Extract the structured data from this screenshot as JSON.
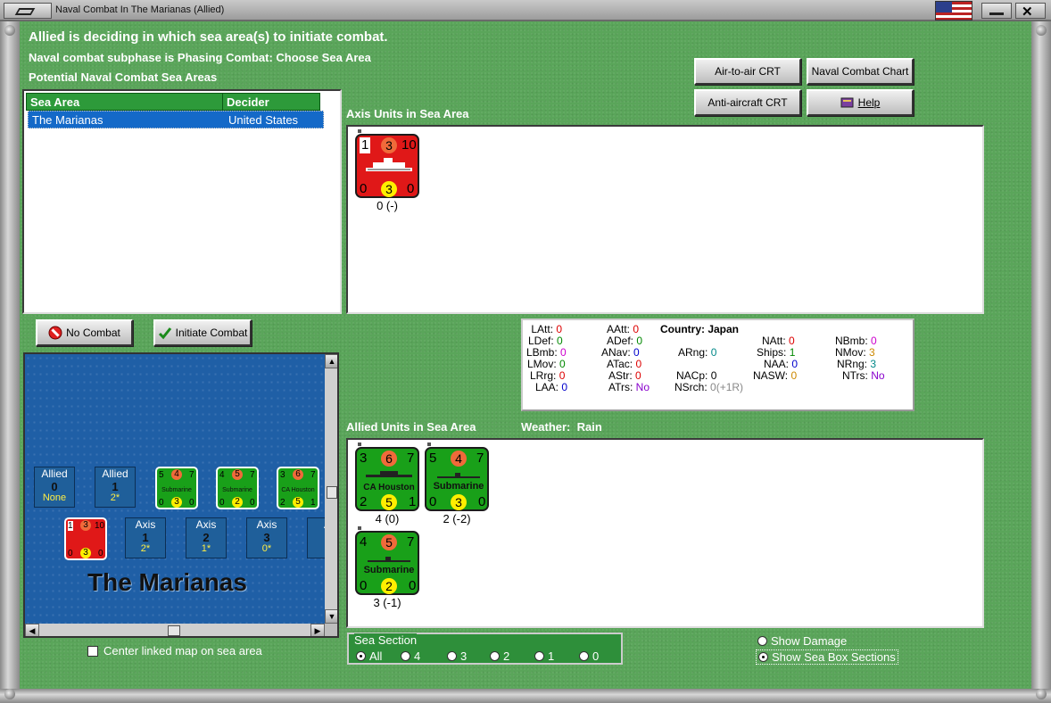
{
  "window": {
    "title": "Naval Combat In The Marianas (Allied)"
  },
  "header": {
    "line1": "Allied is deciding in which sea area(s) to initiate combat.",
    "line2": "Naval combat subphase is Phasing Combat: Choose Sea Area",
    "line3": "Potential Naval Combat Sea Areas"
  },
  "sea_table": {
    "columns": [
      "Sea Area",
      "Decider"
    ],
    "rows": [
      {
        "sea_area": "The Marianas",
        "decider": "United States"
      }
    ]
  },
  "buttons": {
    "air_to_air": "Air-to-air CRT",
    "naval_chart": "Naval Combat Chart",
    "anti_aircraft": "Anti-aircraft CRT",
    "help": "Help",
    "no_combat": "No Combat",
    "initiate": "Initiate Combat"
  },
  "axis": {
    "label": "Axis Units in Sea Area",
    "units": [
      {
        "top": [
          "1",
          "3",
          "10"
        ],
        "bottom": [
          "0",
          "3",
          "0"
        ],
        "name": "",
        "caption": "0 (-)"
      }
    ]
  },
  "stats": {
    "country_label": "Country: Japan",
    "col1": [
      {
        "k": "LAtt:",
        "v": "0"
      },
      {
        "k": "LDef:",
        "v": "0"
      },
      {
        "k": "LBmb:",
        "v": "0"
      },
      {
        "k": "LMov:",
        "v": "0"
      },
      {
        "k": "LRrg:",
        "v": "0"
      },
      {
        "k": "LAA:",
        "v": "0"
      }
    ],
    "col2": [
      {
        "k": "AAtt:",
        "v": "0"
      },
      {
        "k": "ADef:",
        "v": "0"
      },
      {
        "k": "ANav:",
        "v": "0"
      },
      {
        "k": "ATac:",
        "v": "0"
      },
      {
        "k": "AStr:",
        "v": "0"
      },
      {
        "k": "ATrs:",
        "v": "No"
      }
    ],
    "col3": [
      {
        "k": "ARng:",
        "v": "0"
      },
      {
        "k": "NACp:",
        "v": "0"
      },
      {
        "k": "NSrch:",
        "v": "0(+1R)"
      }
    ],
    "col4": [
      {
        "k": "NAtt:",
        "v": "0"
      },
      {
        "k": "Ships:",
        "v": "1"
      },
      {
        "k": "NAA:",
        "v": "0"
      },
      {
        "k": "NASW:",
        "v": "0"
      }
    ],
    "col5": [
      {
        "k": "NBmb:",
        "v": "0"
      },
      {
        "k": "NMov:",
        "v": "3"
      },
      {
        "k": "NRng:",
        "v": "3"
      },
      {
        "k": "NTrs:",
        "v": "No"
      }
    ]
  },
  "allied": {
    "label": "Allied Units in Sea Area",
    "weather_label": "Weather:",
    "weather": "Rain",
    "units": [
      {
        "top": [
          "3",
          "6",
          "7"
        ],
        "bottom": [
          "2",
          "5",
          "1"
        ],
        "name": "CA Houston",
        "caption": "4 (0)"
      },
      {
        "top": [
          "5",
          "4",
          "7"
        ],
        "bottom": [
          "0",
          "3",
          "0"
        ],
        "name": "Submarine",
        "caption": "2 (-2)"
      },
      {
        "top": [
          "4",
          "5",
          "7"
        ],
        "bottom": [
          "0",
          "2",
          "0"
        ],
        "name": "Submarine",
        "caption": "3 (-1)"
      }
    ]
  },
  "map": {
    "title": "The Marianas",
    "allied_boxes": [
      {
        "t": "Allied",
        "v": "0",
        "s": "None"
      },
      {
        "t": "Allied",
        "v": "1",
        "s": "2*"
      }
    ],
    "axis_boxes": [
      {
        "t": "Axis",
        "v": "1",
        "s": "2*"
      },
      {
        "t": "Axis",
        "v": "2",
        "s": "1*"
      },
      {
        "t": "Axis",
        "v": "3",
        "s": "0*"
      },
      {
        "t": "A",
        "v": "",
        "s": ""
      }
    ],
    "mini_units": [
      {
        "top": [
          "5",
          "4",
          "7"
        ],
        "bottom": [
          "0",
          "3",
          "0"
        ],
        "name": "Submarine"
      },
      {
        "top": [
          "4",
          "5",
          "7"
        ],
        "bottom": [
          "0",
          "2",
          "0"
        ],
        "name": "Submarine"
      },
      {
        "top": [
          "3",
          "6",
          "7"
        ],
        "bottom": [
          "2",
          "5",
          "1"
        ],
        "name": "CA Houston"
      }
    ],
    "mini_axis": {
      "top": [
        "1",
        "3",
        "10"
      ],
      "bottom": [
        "0",
        "3",
        "0"
      ]
    }
  },
  "center_checkbox": "Center linked map on sea area",
  "sea_section": {
    "label": "Sea Section",
    "options": [
      "All",
      "4",
      "3",
      "2",
      "1",
      "0"
    ],
    "selected": "All"
  },
  "view_options": {
    "show_damage": "Show Damage",
    "show_sections": "Show Sea Box Sections",
    "selected": "Show Sea Box Sections"
  },
  "colors": {
    "felt": "#5aa55a",
    "sea": "#1f5fa6",
    "axis_unit": "#e01818",
    "allied_unit": "#19a019",
    "selection": "#1469c8",
    "attack_circle": "#f06a3a",
    "move_circle": "#ffee00"
  },
  "icons": {
    "no_combat": "no-entry-icon",
    "initiate": "checkmark-icon",
    "help": "book-icon"
  }
}
